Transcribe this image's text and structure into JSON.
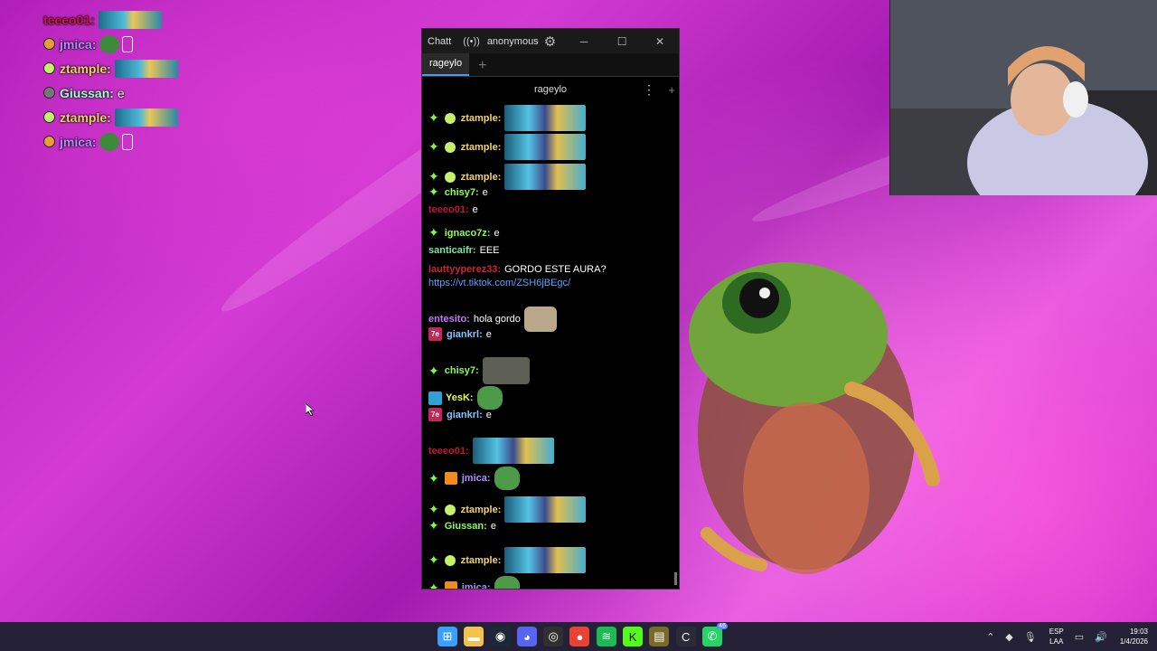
{
  "overlay": [
    {
      "user": "teeeo01",
      "color": "#c21a3d",
      "badge": "none",
      "emote": "wide"
    },
    {
      "user": "jmica",
      "color": "#b48cff",
      "badge": "sunglasses",
      "emote": "pepe"
    },
    {
      "user": "ztample",
      "color": "#f2d06a",
      "badge": "bot",
      "emote": "wide"
    },
    {
      "user": "Giussan",
      "color": "#a6ffd4",
      "badge": "dot",
      "text": "e"
    },
    {
      "user": "ztample",
      "color": "#f2d06a",
      "badge": "bot",
      "emote": "wide"
    },
    {
      "user": "jmica",
      "color": "#b48cff",
      "badge": "sunglasses",
      "emote": "pepe"
    }
  ],
  "window": {
    "app": "Chatt",
    "user": "anonymous",
    "minimize": "─",
    "maximize": "☐",
    "close": "✕",
    "tab": "rageylo",
    "tab_add": "+",
    "channel": "rageylo",
    "menu": "⋮",
    "add": "+"
  },
  "messages": [
    {
      "user": "ztample",
      "color": "#f5d36f",
      "badges": [
        "gem",
        "bot"
      ],
      "emote": "minions"
    },
    {
      "user": "ztample",
      "color": "#f5d36f",
      "badges": [
        "gem",
        "bot"
      ],
      "emote": "minions"
    },
    {
      "user": "ztample",
      "color": "#f5d36f",
      "badges": [
        "gem",
        "bot"
      ],
      "emote": "minions"
    },
    {
      "user": "chisy7",
      "color": "#89ff55",
      "badges": [
        "gem"
      ],
      "text": "e"
    },
    {
      "user": "teeeo01",
      "color": "#c3143a",
      "badges": [],
      "text": "e"
    },
    {
      "user": "ignaco7z",
      "color": "#89ff55",
      "badges": [
        "gem"
      ],
      "text": "e"
    },
    {
      "user": "santicaifr",
      "color": "#7de8a0",
      "badges": [],
      "text": "EEE"
    },
    {
      "user": "lauttyyperez33",
      "color": "#d0203a",
      "badges": [],
      "text": "GORDO ESTE AURA?"
    },
    {
      "link": "https://vt.tiktok.com/ZSH6jBEgc/"
    },
    {
      "user": "entesito",
      "color": "#c774ff",
      "badges": [],
      "text": "hola gordo",
      "emote": "cat"
    },
    {
      "user": "giankrl",
      "color": "#7ec7ff",
      "badges": [
        "7tv"
      ],
      "text": "e"
    },
    {
      "user": "chisy7",
      "color": "#89ff55",
      "badges": [
        "gem"
      ],
      "emote": "dark"
    },
    {
      "user": "YesK",
      "color": "#e9ff56",
      "badges": [
        "hammer"
      ],
      "emote": "pepe"
    },
    {
      "user": "giankrl",
      "color": "#7ec7ff",
      "badges": [
        "7tv"
      ],
      "text": "e"
    },
    {
      "user": "teeeo01",
      "color": "#c3143a",
      "badges": [],
      "emote": "minions"
    },
    {
      "user": "jmica",
      "color": "#b48cff",
      "badges": [
        "gem",
        "box"
      ],
      "emote": "pepe"
    },
    {
      "user": "ztample",
      "color": "#f5d36f",
      "badges": [
        "gem",
        "bot"
      ],
      "emote": "minions"
    },
    {
      "user": "Giussan",
      "color": "#89ff55",
      "badges": [
        "gem"
      ],
      "text": "e"
    },
    {
      "user": "ztample",
      "color": "#f5d36f",
      "badges": [
        "gem",
        "bot"
      ],
      "emote": "minions"
    },
    {
      "user": "jmica",
      "color": "#b48cff",
      "badges": [
        "gem",
        "box"
      ],
      "emote": "pepe"
    }
  ],
  "taskbar": {
    "icons": [
      "windows-icon",
      "file-explorer-icon",
      "steam-icon",
      "discord-icon",
      "obs-icon",
      "chrome-icon",
      "spotify-icon",
      "kick-icon",
      "app-icon",
      "chatterino-icon",
      "whatsapp-icon"
    ],
    "whatsapp_badge": "46",
    "lang_top": "ESP",
    "lang_bottom": "LAA",
    "time": "19:03",
    "date": "1/4/2026"
  }
}
